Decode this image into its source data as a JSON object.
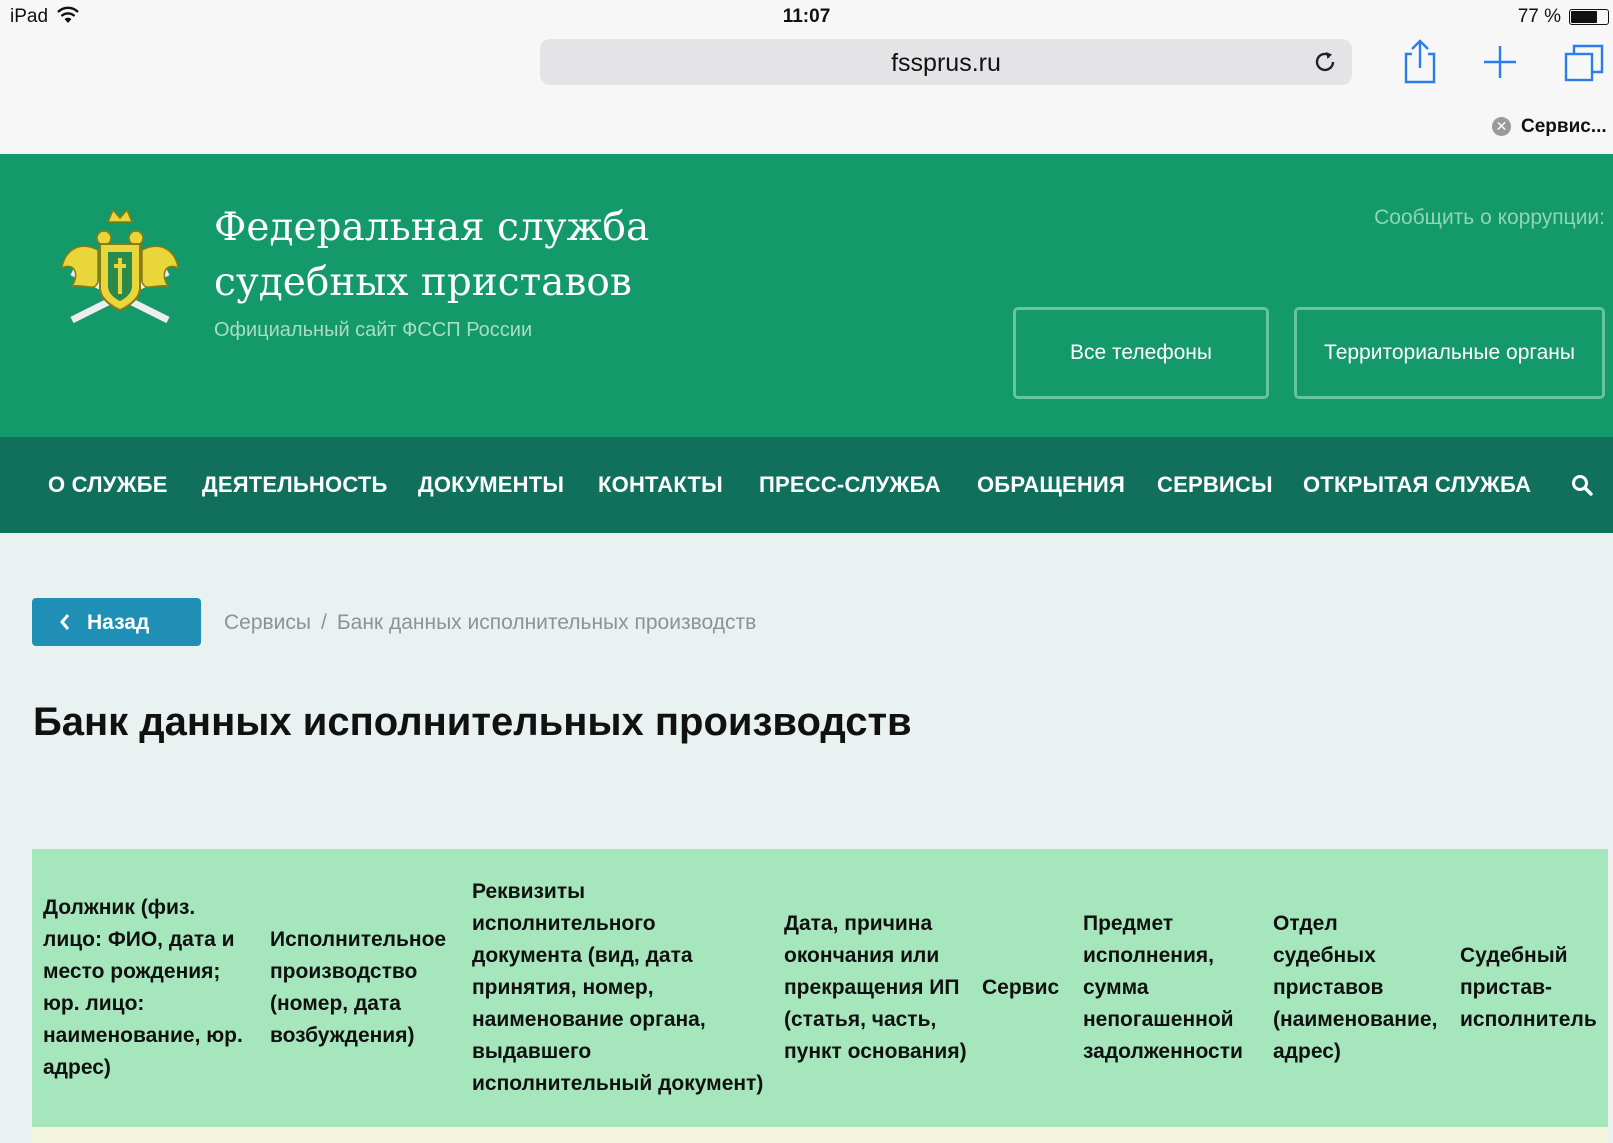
{
  "status_bar": {
    "device": "iPad",
    "time": "11:07",
    "battery": "77 %",
    "battery_level": 0.77
  },
  "browser": {
    "url": "fssprus.ru",
    "tab_title": "Сервис..."
  },
  "site": {
    "title_line1": "Федеральная служба",
    "title_line2": "судебных приставов",
    "subtitle": "Официальный сайт ФССП России",
    "corruption_link": "Сообщить о коррупции:",
    "btn_phones": "Все телефоны",
    "btn_territorial": "Территориальные органы"
  },
  "nav": {
    "items": [
      "О СЛУЖБЕ",
      "ДЕЯТЕЛЬНОСТЬ",
      "ДОКУМЕНТЫ",
      "КОНТАКТЫ",
      "ПРЕСС-СЛУЖБА",
      "ОБРАЩЕНИЯ",
      "СЕРВИСЫ",
      "ОТКРЫТАЯ СЛУЖБА"
    ]
  },
  "content": {
    "back_label": "Назад",
    "breadcrumb": [
      "Сервисы",
      "Банк данных исполнительных производств"
    ],
    "page_title": "Банк данных исполнительных производств"
  },
  "table": {
    "columns": [
      "Должник (физ. лицо: ФИО, дата и место рождения; юр. лицо: наименование, юр. адрес)",
      "Исполнительное производство (номер, дата возбуждения)",
      "Реквизиты исполнительного документа (вид, дата принятия, номер, наименование органа, выдавшего исполнительный документ)",
      "Дата, причина окончания или прекращения ИП (статья, часть, пункт основания)",
      "Сервис",
      "Предмет исполнения, сумма непогашенной задолженности",
      "Отдел судебных приставов (наименование, адрес)",
      "Судебный пристав-исполнитель"
    ]
  },
  "colors": {
    "header_green": "#14996b",
    "nav_green": "#11705c",
    "back_button": "#1f8fb6",
    "table_header": "#a6e6bd"
  }
}
